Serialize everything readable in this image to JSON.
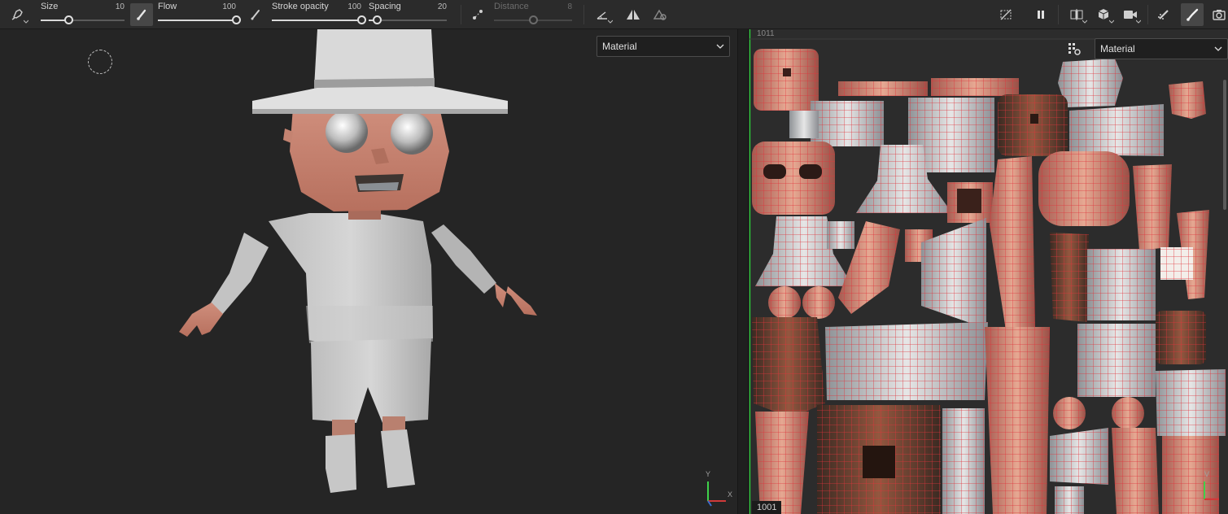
{
  "toolbar": {
    "tool_icon": "stamp-brush-icon",
    "sliders": [
      {
        "label": "Size",
        "value": "10",
        "fraction": 0.33
      },
      {
        "label": "Flow",
        "value": "100",
        "fraction": 1.0
      },
      {
        "label": "Stroke opacity",
        "value": "100",
        "fraction": 1.0
      },
      {
        "label": "Spacing",
        "value": "20",
        "fraction": 0.1
      },
      {
        "label": "Distance",
        "value": "8",
        "fraction": 0.5,
        "disabled": true
      }
    ],
    "icons": [
      "brush-mode-icon",
      "paint-flow-icon",
      "lazy-mouse-icon",
      "line-angle-icon",
      "symmetry-icon",
      "position-jitter-icon",
      "hide-uv-icon",
      "pause-icon",
      "view-split-icon",
      "cube-view-icon",
      "camera-icon",
      "paint-brush-icon",
      "active-brush-icon",
      "screenshot-icon"
    ]
  },
  "viewport3d": {
    "material_dropdown": "Material",
    "axis": {
      "y": "Y",
      "x": "X"
    }
  },
  "viewport2d": {
    "material_dropdown": "Material",
    "udim_top": "1011",
    "udim_bottom": "1001",
    "axis": {
      "v": "V"
    }
  },
  "colors": {
    "toolbar_bg": "#2b2b2b",
    "viewport_bg": "#252525",
    "uv_wire": "#e0343c",
    "skin": "#c98a78",
    "cloth": "#cdcdcd",
    "uv_border": "#2adb3a"
  }
}
